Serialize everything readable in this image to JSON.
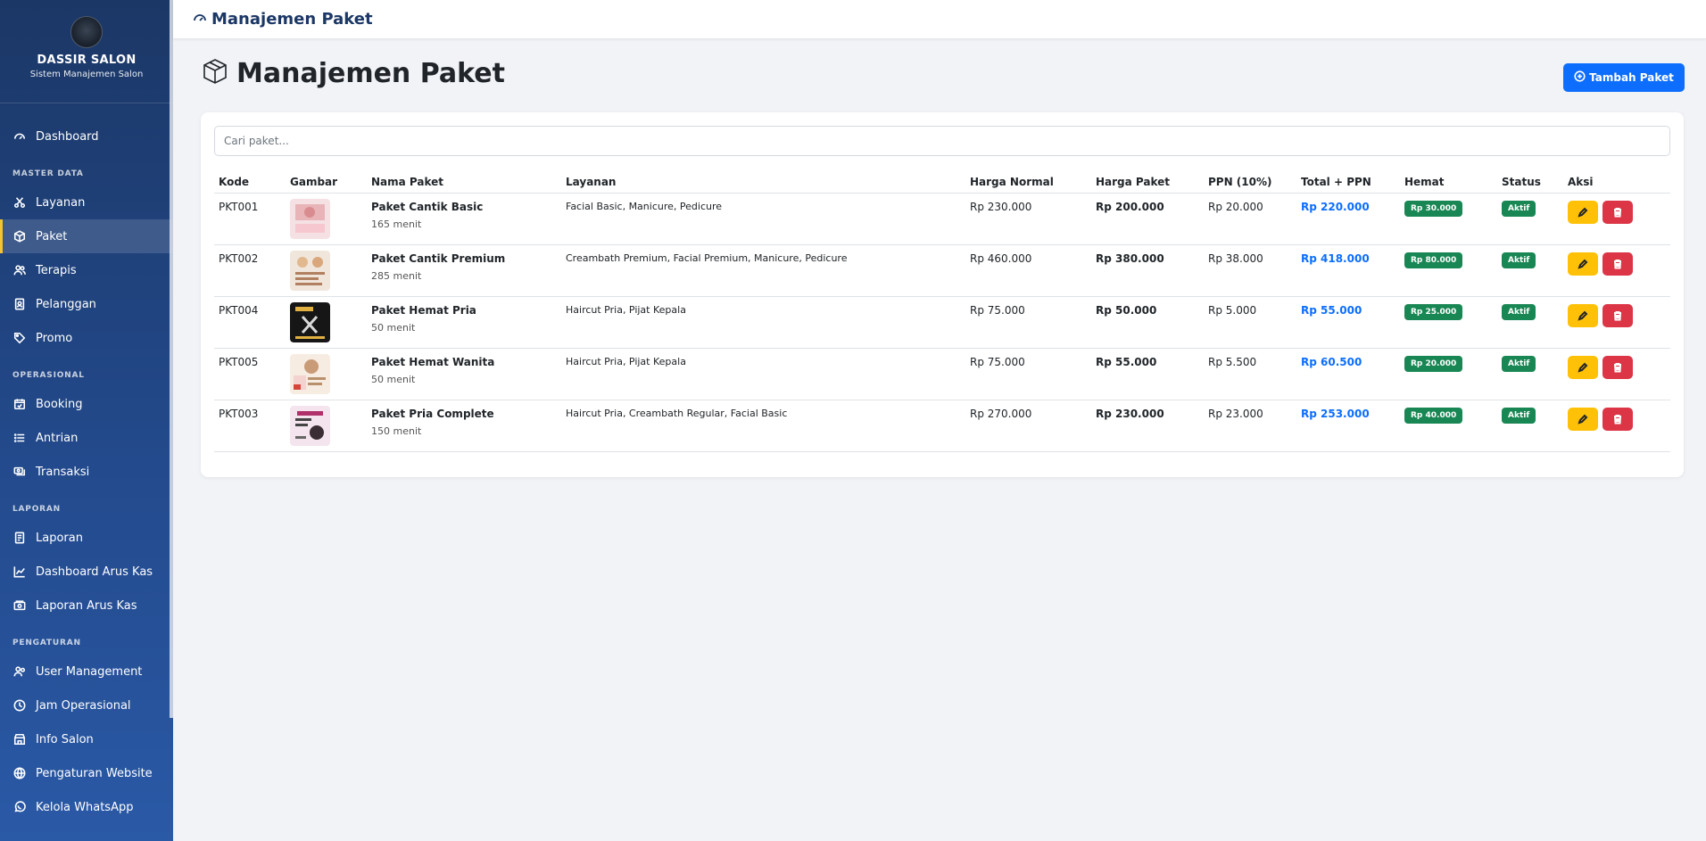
{
  "brand": {
    "name": "DASSIR SALON",
    "subtitle": "Sistem Manajemen Salon"
  },
  "sidebar": {
    "items": [
      {
        "label": "Dashboard",
        "icon": "gauge-icon"
      },
      {
        "section": "MASTER DATA"
      },
      {
        "label": "Layanan",
        "icon": "scissors-icon"
      },
      {
        "label": "Paket",
        "icon": "box-icon",
        "active": true
      },
      {
        "label": "Terapis",
        "icon": "people-icon"
      },
      {
        "label": "Pelanggan",
        "icon": "person-card-icon"
      },
      {
        "label": "Promo",
        "icon": "tag-icon"
      },
      {
        "section": "OPERASIONAL"
      },
      {
        "label": "Booking",
        "icon": "calendar-check-icon"
      },
      {
        "label": "Antrian",
        "icon": "list-icon"
      },
      {
        "label": "Transaksi",
        "icon": "cash-stack-icon"
      },
      {
        "section": "LAPORAN"
      },
      {
        "label": "Laporan",
        "icon": "file-text-icon"
      },
      {
        "label": "Dashboard Arus Kas",
        "icon": "chart-line-icon"
      },
      {
        "label": "Laporan Arus Kas",
        "icon": "cash-icon"
      },
      {
        "section": "PENGATURAN"
      },
      {
        "label": "User Management",
        "icon": "users-gear-icon"
      },
      {
        "label": "Jam Operasional",
        "icon": "clock-icon"
      },
      {
        "label": "Info Salon",
        "icon": "shop-icon"
      },
      {
        "label": "Pengaturan Website",
        "icon": "globe-icon"
      },
      {
        "label": "Kelola WhatsApp",
        "icon": "whatsapp-icon"
      }
    ]
  },
  "topbar": {
    "title": "Manajemen Paket"
  },
  "page": {
    "title": "Manajemen Paket",
    "add_button": "Tambah Paket"
  },
  "search": {
    "placeholder": "Cari paket..."
  },
  "table": {
    "columns": [
      "Kode",
      "Gambar",
      "Nama Paket",
      "Layanan",
      "Harga Normal",
      "Harga Paket",
      "PPN (10%)",
      "Total + PPN",
      "Hemat",
      "Status",
      "Aksi"
    ],
    "rows": [
      {
        "kode": "PKT001",
        "nama": "Paket Cantik Basic",
        "durasi": "165 menit",
        "layanan": "Facial Basic, Manicure, Pedicure",
        "normal": "Rp 230.000",
        "paket": "Rp 200.000",
        "ppn": "Rp 20.000",
        "total": "Rp 220.000",
        "hemat": "Rp 30.000",
        "status": "Aktif"
      },
      {
        "kode": "PKT002",
        "nama": "Paket Cantik Premium",
        "durasi": "285 menit",
        "layanan": "Creambath Premium, Facial Premium, Manicure, Pedicure",
        "normal": "Rp 460.000",
        "paket": "Rp 380.000",
        "ppn": "Rp 38.000",
        "total": "Rp 418.000",
        "hemat": "Rp 80.000",
        "status": "Aktif"
      },
      {
        "kode": "PKT004",
        "nama": "Paket Hemat Pria",
        "durasi": "50 menit",
        "layanan": "Haircut Pria, Pijat Kepala",
        "normal": "Rp 75.000",
        "paket": "Rp 50.000",
        "ppn": "Rp 5.000",
        "total": "Rp 55.000",
        "hemat": "Rp 25.000",
        "status": "Aktif"
      },
      {
        "kode": "PKT005",
        "nama": "Paket Hemat Wanita",
        "durasi": "50 menit",
        "layanan": "Haircut Pria, Pijat Kepala",
        "normal": "Rp 75.000",
        "paket": "Rp 55.000",
        "ppn": "Rp 5.500",
        "total": "Rp 60.500",
        "hemat": "Rp 20.000",
        "status": "Aktif"
      },
      {
        "kode": "PKT003",
        "nama": "Paket Pria Complete",
        "durasi": "150 menit",
        "layanan": "Haircut Pria, Creambath Regular, Facial Basic",
        "normal": "Rp 270.000",
        "paket": "Rp 230.000",
        "ppn": "Rp 23.000",
        "total": "Rp 253.000",
        "hemat": "Rp 40.000",
        "status": "Aktif"
      }
    ]
  },
  "colors": {
    "sidebar_top": "#1b3766",
    "sidebar_bottom": "#2a59a6",
    "primary": "#0d6efd",
    "success": "#198754",
    "warning": "#ffc107",
    "danger": "#dc3545",
    "active_marker": "#f4c430"
  }
}
